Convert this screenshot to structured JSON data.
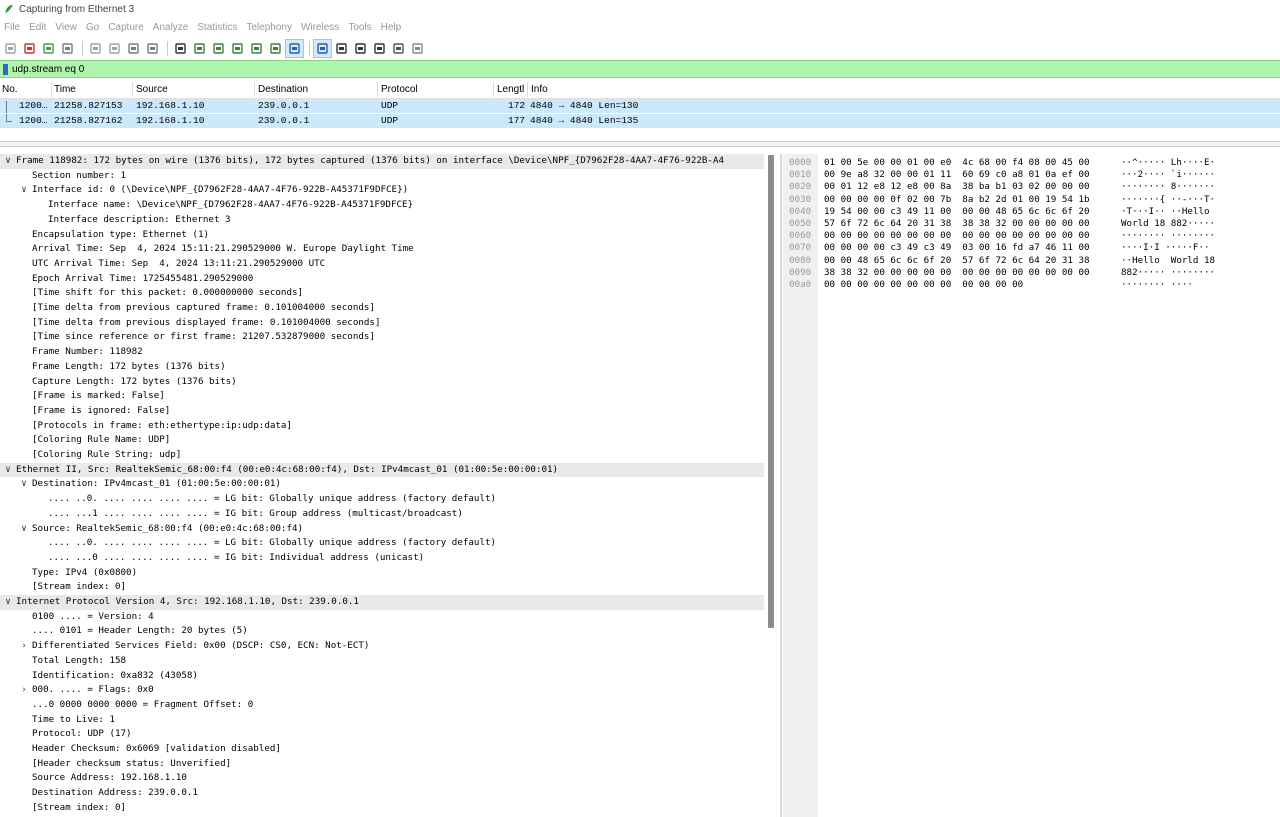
{
  "window": {
    "title": "Capturing from Ethernet 3"
  },
  "menu": [
    "File",
    "Edit",
    "View",
    "Go",
    "Capture",
    "Analyze",
    "Statistics",
    "Telephony",
    "Wireless",
    "Tools",
    "Help"
  ],
  "toolbar": {
    "icons": [
      "shark-fin-start-icon",
      "stop-capture-icon",
      "restart-capture-icon",
      "capture-options-icon",
      "open-file-icon",
      "save-file-icon",
      "close-file-icon",
      "reload-file-icon",
      "find-packet-icon",
      "go-back-icon",
      "go-forward-icon",
      "go-to-packet-icon",
      "go-first-icon",
      "go-last-icon",
      "autoscroll-icon",
      "colorize-icon",
      "zoom-in-icon",
      "zoom-out-icon",
      "normal-size-icon",
      "resize-columns-icon",
      "layout-icon"
    ]
  },
  "filter": {
    "value": "udp.stream eq 0"
  },
  "packet_list": {
    "columns": [
      "No.",
      "Time",
      "Source",
      "Destination",
      "Protocol",
      "Lengtl",
      "Info"
    ],
    "rows": [
      {
        "no": "1200…",
        "time": "21258.827153",
        "src": "192.168.1.10",
        "dst": "239.0.0.1",
        "proto": "UDP",
        "len": "172",
        "info": "4840 → 4840 Len=130"
      },
      {
        "no": "1200…",
        "time": "21258.827162",
        "src": "192.168.1.10",
        "dst": "239.0.0.1",
        "proto": "UDP",
        "len": "177",
        "info": "4840 → 4840 Len=135"
      }
    ]
  },
  "details": [
    {
      "arrow": "∨",
      "indent": 0,
      "text": "Frame 118982: 172 bytes on wire (1376 bits), 172 bytes captured (1376 bits) on interface \\Device\\NPF_{D7962F28-4AA7-4F76-922B-A4",
      "hl": true
    },
    {
      "arrow": "",
      "indent": 1,
      "text": "Section number: 1"
    },
    {
      "arrow": "∨",
      "indent": 1,
      "text": "Interface id: 0 (\\Device\\NPF_{D7962F28-4AA7-4F76-922B-A45371F9DFCE})"
    },
    {
      "arrow": "",
      "indent": 2,
      "text": "Interface name: \\Device\\NPF_{D7962F28-4AA7-4F76-922B-A45371F9DFCE}"
    },
    {
      "arrow": "",
      "indent": 2,
      "text": "Interface description: Ethernet 3"
    },
    {
      "arrow": "",
      "indent": 1,
      "text": "Encapsulation type: Ethernet (1)"
    },
    {
      "arrow": "",
      "indent": 1,
      "text": "Arrival Time: Sep  4, 2024 15:11:21.290529000 W. Europe Daylight Time"
    },
    {
      "arrow": "",
      "indent": 1,
      "text": "UTC Arrival Time: Sep  4, 2024 13:11:21.290529000 UTC"
    },
    {
      "arrow": "",
      "indent": 1,
      "text": "Epoch Arrival Time: 1725455481.290529000"
    },
    {
      "arrow": "",
      "indent": 1,
      "text": "[Time shift for this packet: 0.000000000 seconds]"
    },
    {
      "arrow": "",
      "indent": 1,
      "text": "[Time delta from previous captured frame: 0.101004000 seconds]"
    },
    {
      "arrow": "",
      "indent": 1,
      "text": "[Time delta from previous displayed frame: 0.101004000 seconds]"
    },
    {
      "arrow": "",
      "indent": 1,
      "text": "[Time since reference or first frame: 21207.532879000 seconds]"
    },
    {
      "arrow": "",
      "indent": 1,
      "text": "Frame Number: 118982"
    },
    {
      "arrow": "",
      "indent": 1,
      "text": "Frame Length: 172 bytes (1376 bits)"
    },
    {
      "arrow": "",
      "indent": 1,
      "text": "Capture Length: 172 bytes (1376 bits)"
    },
    {
      "arrow": "",
      "indent": 1,
      "text": "[Frame is marked: False]"
    },
    {
      "arrow": "",
      "indent": 1,
      "text": "[Frame is ignored: False]"
    },
    {
      "arrow": "",
      "indent": 1,
      "text": "[Protocols in frame: eth:ethertype:ip:udp:data]"
    },
    {
      "arrow": "",
      "indent": 1,
      "text": "[Coloring Rule Name: UDP]"
    },
    {
      "arrow": "",
      "indent": 1,
      "text": "[Coloring Rule String: udp]"
    },
    {
      "arrow": "∨",
      "indent": 0,
      "text": "Ethernet II, Src: RealtekSemic_68:00:f4 (00:e0:4c:68:00:f4), Dst: IPv4mcast_01 (01:00:5e:00:00:01)",
      "hl": true
    },
    {
      "arrow": "∨",
      "indent": 1,
      "text": "Destination: IPv4mcast_01 (01:00:5e:00:00:01)"
    },
    {
      "arrow": "",
      "indent": 2,
      "text": ".... ..0. .... .... .... .... = LG bit: Globally unique address (factory default)"
    },
    {
      "arrow": "",
      "indent": 2,
      "text": ".... ...1 .... .... .... .... = IG bit: Group address (multicast/broadcast)"
    },
    {
      "arrow": "∨",
      "indent": 1,
      "text": "Source: RealtekSemic_68:00:f4 (00:e0:4c:68:00:f4)"
    },
    {
      "arrow": "",
      "indent": 2,
      "text": ".... ..0. .... .... .... .... = LG bit: Globally unique address (factory default)"
    },
    {
      "arrow": "",
      "indent": 2,
      "text": ".... ...0 .... .... .... .... = IG bit: Individual address (unicast)"
    },
    {
      "arrow": "",
      "indent": 1,
      "text": "Type: IPv4 (0x0800)"
    },
    {
      "arrow": "",
      "indent": 1,
      "text": "[Stream index: 0]"
    },
    {
      "arrow": "∨",
      "indent": 0,
      "text": "Internet Protocol Version 4, Src: 192.168.1.10, Dst: 239.0.0.1",
      "hl": true
    },
    {
      "arrow": "",
      "indent": 1,
      "text": "0100 .... = Version: 4"
    },
    {
      "arrow": "",
      "indent": 1,
      "text": ".... 0101 = Header Length: 20 bytes (5)"
    },
    {
      "arrow": "›",
      "indent": 1,
      "text": "Differentiated Services Field: 0x00 (DSCP: CS0, ECN: Not-ECT)"
    },
    {
      "arrow": "",
      "indent": 1,
      "text": "Total Length: 158"
    },
    {
      "arrow": "",
      "indent": 1,
      "text": "Identification: 0xa832 (43058)"
    },
    {
      "arrow": "›",
      "indent": 1,
      "text": "000. .... = Flags: 0x0"
    },
    {
      "arrow": "",
      "indent": 1,
      "text": "...0 0000 0000 0000 = Fragment Offset: 0"
    },
    {
      "arrow": "",
      "indent": 1,
      "text": "Time to Live: 1"
    },
    {
      "arrow": "",
      "indent": 1,
      "text": "Protocol: UDP (17)"
    },
    {
      "arrow": "",
      "indent": 1,
      "text": "Header Checksum: 0x6069 [validation disabled]"
    },
    {
      "arrow": "",
      "indent": 1,
      "text": "[Header checksum status: Unverified]"
    },
    {
      "arrow": "",
      "indent": 1,
      "text": "Source Address: 192.168.1.10"
    },
    {
      "arrow": "",
      "indent": 1,
      "text": "Destination Address: 239.0.0.1"
    },
    {
      "arrow": "",
      "indent": 1,
      "text": "[Stream index: 0]"
    }
  ],
  "bytes": [
    {
      "off": "0000",
      "hex": "01 00 5e 00 00 01 00 e0  4c 68 00 f4 08 00 45 00",
      "asc": "··^····· Lh····E·"
    },
    {
      "off": "0010",
      "hex": "00 9e a8 32 00 00 01 11  60 69 c0 a8 01 0a ef 00",
      "asc": "···2···· `i······"
    },
    {
      "off": "0020",
      "hex": "00 01 12 e8 12 e8 00 8a  38 ba b1 03 02 00 00 00",
      "asc": "········ 8·······"
    },
    {
      "off": "0030",
      "hex": "00 00 00 00 0f 02 00 7b  8a b2 2d 01 00 19 54 1b",
      "asc": "·······{ ··-···T·"
    },
    {
      "off": "0040",
      "hex": "19 54 00 00 c3 49 11 00  00 00 48 65 6c 6c 6f 20",
      "asc": "·T···I·· ··Hello "
    },
    {
      "off": "0050",
      "hex": "57 6f 72 6c 64 20 31 38  38 38 32 00 00 00 00 00",
      "asc": "World 18 882·····"
    },
    {
      "off": "0060",
      "hex": "00 00 00 00 00 00 00 00  00 00 00 00 00 00 00 00",
      "asc": "········ ········"
    },
    {
      "off": "0070",
      "hex": "00 00 00 00 c3 49 c3 49  03 00 16 fd a7 46 11 00",
      "asc": "····I·I ·····F··"
    },
    {
      "off": "0080",
      "hex": "00 00 48 65 6c 6c 6f 20  57 6f 72 6c 64 20 31 38",
      "asc": "··Hello  World 18"
    },
    {
      "off": "0090",
      "hex": "38 38 32 00 00 00 00 00  00 00 00 00 00 00 00 00",
      "asc": "882····· ········"
    },
    {
      "off": "00a0",
      "hex": "00 00 00 00 00 00 00 00  00 00 00 00",
      "asc": "········ ····"
    }
  ]
}
